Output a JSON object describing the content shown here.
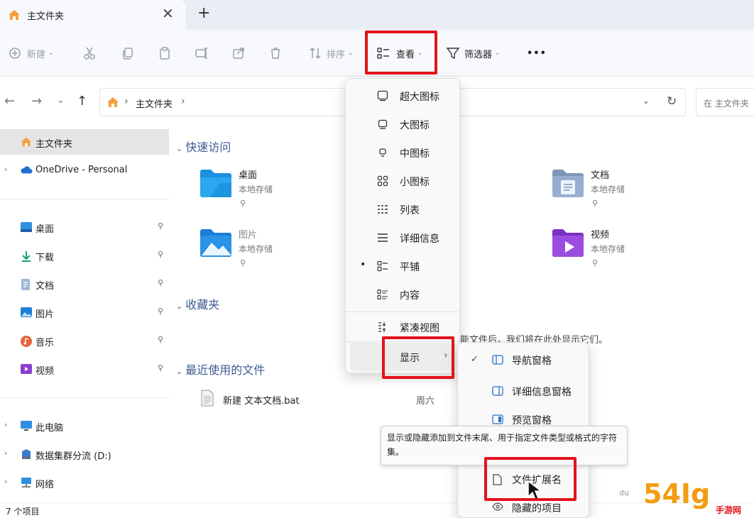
{
  "tabs": {
    "active_title": "主文件夹",
    "close_glyph": "✕",
    "new_tab_glyph": "+"
  },
  "toolbar": {
    "new_label": "新建",
    "sort_label": "排序",
    "view_label": "查看",
    "filter_label": "筛选器",
    "more_glyph": "•••"
  },
  "nav": {
    "back_glyph": "←",
    "forward_glyph": "→",
    "history_glyph": "⌄",
    "up_glyph": "↑",
    "breadcrumb_sep": "›",
    "breadcrumb_current": "主文件夹",
    "dropdown_glyph": "⌄",
    "refresh_glyph": "↻",
    "search_placeholder": "在 主文件夹"
  },
  "sidebar": {
    "home": "主文件夹",
    "onedrive": "OneDrive - Personal",
    "expand_glyph": "›",
    "pin_glyph": "📌",
    "pinned": [
      {
        "label": "桌面"
      },
      {
        "label": "下载"
      },
      {
        "label": "文档"
      },
      {
        "label": "图片"
      },
      {
        "label": "音乐"
      },
      {
        "label": "视频"
      }
    ],
    "this_pc": "此电脑",
    "drive_d": "数据集群分流 (D:)",
    "network": "网络"
  },
  "content": {
    "quick_access_title": "快速访问",
    "favorites_title": "收藏夹",
    "recent_title": "最近使用的文件",
    "caret_glyph": "⌄",
    "quick_items": [
      {
        "name": "桌面",
        "sub": "本地存储"
      },
      {
        "name": "图片",
        "sub": "本地存储"
      },
      {
        "name": "文档",
        "sub": "本地存储"
      },
      {
        "name": "视频",
        "sub": "本地存储"
      }
    ],
    "empty_favorites_text": "能文件后，我们将在此处显示它们。",
    "recent_files": [
      {
        "name": "新建 文本文档.bat",
        "date": "周六"
      }
    ]
  },
  "status": {
    "item_count": "7 个项目"
  },
  "view_menu": {
    "items": [
      "超大图标",
      "大图标",
      "中图标",
      "小图标",
      "列表",
      "详细信息",
      "平铺",
      "内容",
      "紧凑视图"
    ],
    "selected_dot": "•",
    "show_label": "显示",
    "submenu_arrow": "›"
  },
  "show_menu": {
    "check_glyph": "✓",
    "items": [
      "导航窗格",
      "详细信息窗格",
      "预览窗格",
      "文件扩展名",
      "隐藏的项目"
    ]
  },
  "tooltip": {
    "text": "显示或隐藏添加到文件末尾、用于指定文件类型或格式的字符集。"
  },
  "watermark": {
    "logo": "54Ig",
    "site": "手游网 .com.cn",
    "du": "du"
  },
  "colors": {
    "highlight_red": "#e3121b",
    "folder_blue": "#2f8ee0",
    "section_blue": "#3b5b91",
    "video_purple": "#8a3fd1"
  }
}
